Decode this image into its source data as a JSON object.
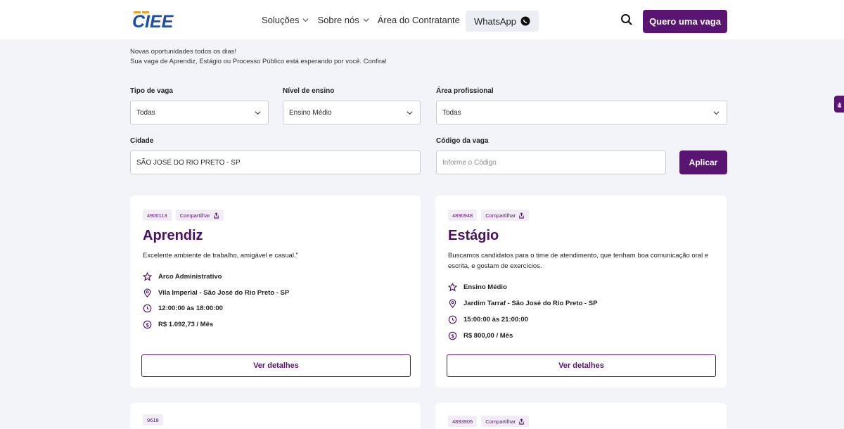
{
  "brand": {
    "logo_text": "CIEE",
    "accent": "#5a1472"
  },
  "nav": {
    "items": [
      {
        "label": "Soluções",
        "has_dropdown": true
      },
      {
        "label": "Sobre nós",
        "has_dropdown": true
      },
      {
        "label": "Área do Contratante",
        "has_dropdown": false
      }
    ],
    "whatsapp_label": "WhatsApp",
    "cta_label": "Quero uma vaga"
  },
  "intro": {
    "line1": "Novas oportunidades todos os dias!",
    "line2": "Sua vaga de Aprendiz, Estágio ou Processo Público está esperando por você. Confira!"
  },
  "filters": {
    "tipo_label": "Tipo de vaga",
    "tipo_value": "Todas",
    "nivel_label": "Nível de ensino",
    "nivel_value": "Ensino Médio",
    "area_label": "Área profissional",
    "area_value": "Todas",
    "cidade_label": "Cidade",
    "cidade_value": "SÃO JOSÉ DO RIO PRETO - SP",
    "codigo_label": "Código da vaga",
    "codigo_placeholder": "Informe o Código",
    "apply_label": "Aplicar"
  },
  "cards": [
    {
      "code": "4900113",
      "share": "Compartilhar",
      "title": "Aprendiz",
      "description": "Excelente ambiente de trabalho, amigável e casual.\"",
      "area": "Arco Administrativo",
      "location": "Vila Imperial - São José do Rio Preto - SP",
      "hours": "12:00:00 às 18:00:00",
      "salary": "R$ 1.092,73 / Mês",
      "details_label": "Ver detalhes"
    },
    {
      "code": "4890948",
      "share": "Compartilhar",
      "title": "Estágio",
      "description": "Buscamos candidatos para o time de atendimento, que tenham boa comunicação oral e escrita, e gostam de exercícios.",
      "area": "Ensino Médio",
      "location": "Jardim Tarraf - São José do Rio Preto - SP",
      "hours": "15:00:00 às 21:00:00",
      "salary": "R$ 800,00 / Mês",
      "details_label": "Ver detalhes"
    },
    {
      "code": "9618"
    },
    {
      "code": "4893905",
      "share": "Compartilhar"
    }
  ]
}
